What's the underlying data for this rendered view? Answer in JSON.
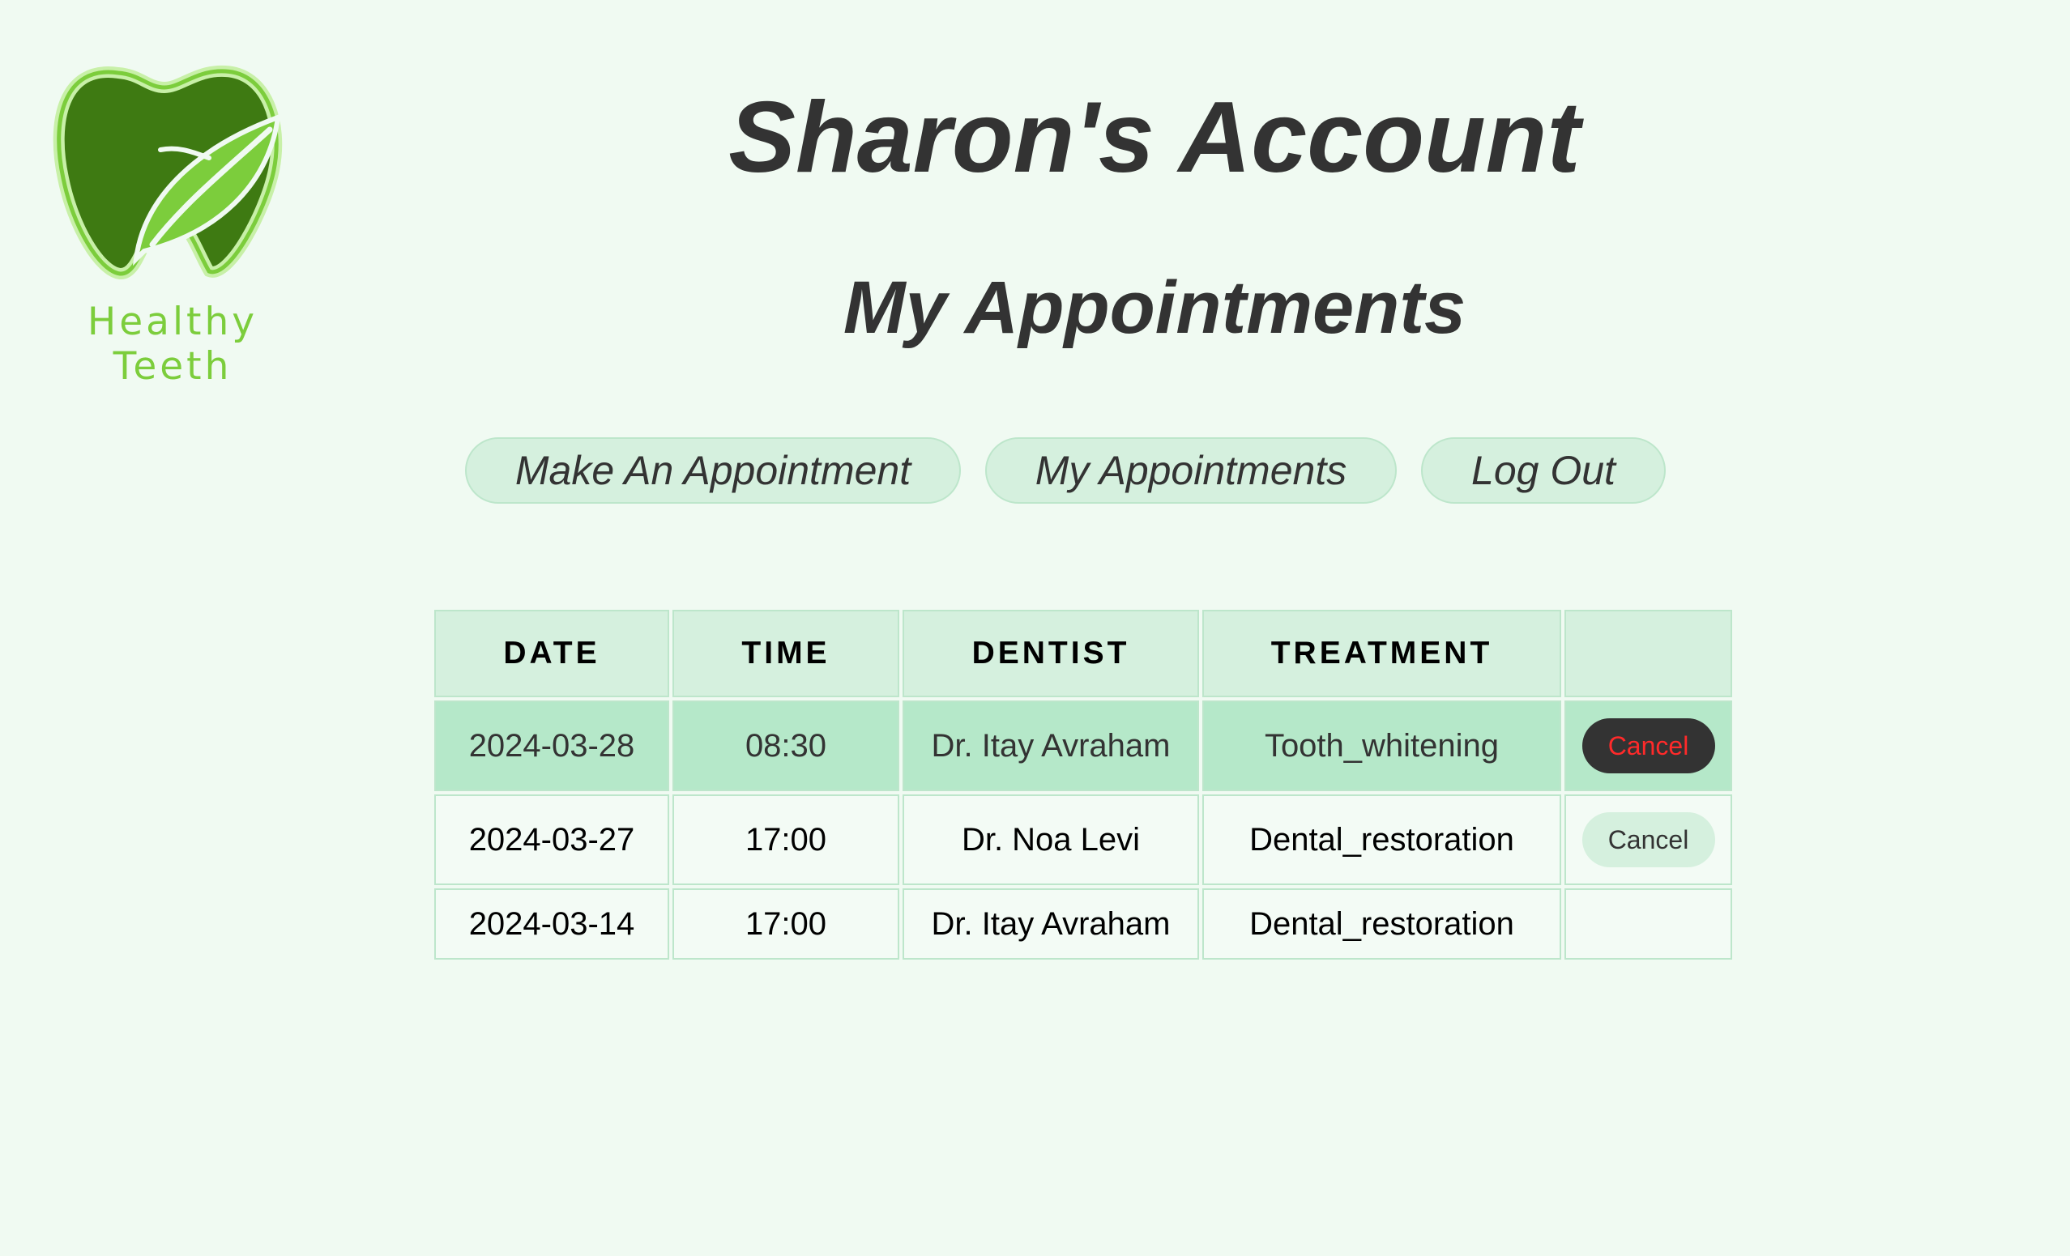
{
  "brand": {
    "name": "Healthy Teeth",
    "colors": {
      "tooth_dark": "#3e7a12",
      "leaf": "#7ccd3c"
    }
  },
  "header": {
    "title": "Sharon's Account",
    "subtitle": "My Appointments"
  },
  "nav": {
    "make_appointment": "Make An Appointment",
    "my_appointments": "My Appointments",
    "log_out": "Log Out"
  },
  "table": {
    "columns": [
      "DATE",
      "TIME",
      "DENTIST",
      "TREATMENT",
      ""
    ],
    "rows": [
      {
        "date": "2024-03-28",
        "time": "08:30",
        "dentist": "Dr. Itay Avraham",
        "treatment": "Tooth_whitening",
        "action": "Cancel"
      },
      {
        "date": "2024-03-27",
        "time": "17:00",
        "dentist": "Dr. Noa Levi",
        "treatment": "Dental_restoration",
        "action": "Cancel"
      },
      {
        "date": "2024-03-14",
        "time": "17:00",
        "dentist": "Dr. Itay Avraham",
        "treatment": "Dental_restoration",
        "action": ""
      }
    ]
  },
  "colors": {
    "background": "#f0faf2",
    "accent_light": "#d5f0de",
    "row_highlight": "#b5e8c9",
    "cancel_text": "#ff2a2a",
    "text_dark": "#333333"
  }
}
